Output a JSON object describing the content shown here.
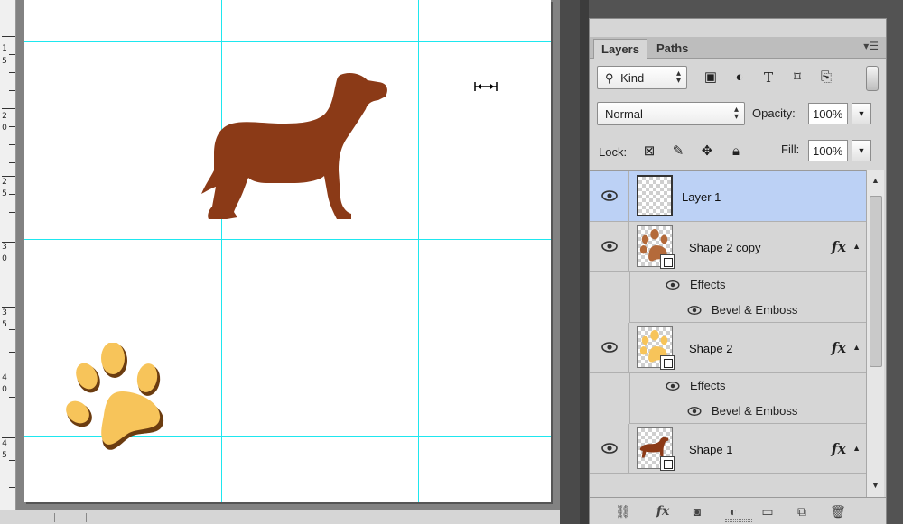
{
  "panel": {
    "collapse_icon": "double-chevron-left-icon",
    "close_icon": "close-icon",
    "tabs": [
      {
        "label": "Layers",
        "active": true
      },
      {
        "label": "Paths",
        "active": false
      }
    ],
    "menu_icon": "panel-menu-icon"
  },
  "filter": {
    "kind_label": "Kind",
    "icons": [
      "image-filter-icon",
      "adjustment-filter-icon",
      "type-filter-icon",
      "shape-filter-icon",
      "smart-object-filter-icon"
    ]
  },
  "blend": {
    "mode": "Normal",
    "opacity_label": "Opacity:",
    "opacity_value": "100%"
  },
  "lock": {
    "label": "Lock:",
    "icons": [
      "lock-transparent-icon",
      "lock-image-icon",
      "lock-position-icon",
      "lock-all-icon"
    ],
    "fill_label": "Fill:",
    "fill_value": "100%"
  },
  "layers": [
    {
      "name": "Layer 1",
      "selected": true,
      "visible": true,
      "thumb": "empty"
    },
    {
      "name": "Shape 2 copy",
      "selected": false,
      "visible": true,
      "thumb": "brown-paw",
      "fx": "fx",
      "effects_label": "Effects",
      "effect": "Bevel & Emboss"
    },
    {
      "name": "Shape 2",
      "selected": false,
      "visible": true,
      "thumb": "yellow-paw",
      "fx": "fx",
      "effects_label": "Effects",
      "effect": "Bevel & Emboss"
    },
    {
      "name": "Shape 1",
      "selected": false,
      "visible": true,
      "thumb": "dog",
      "fx": "fx"
    }
  ],
  "footer_icons": [
    "link-layers-icon",
    "fx-icon",
    "add-mask-icon",
    "adjustment-layer-icon",
    "new-group-icon",
    "new-layer-icon",
    "trash-icon"
  ],
  "canvas": {
    "guide_color": "#1ee7ef",
    "dog_color": "#8b3a17",
    "paw_color": "#f7c45a",
    "paw_shadow_color": "#6b3c10"
  },
  "ruler_numbers": [
    "1",
    "5",
    "2",
    "0",
    "2",
    "5",
    "3",
    "0",
    "3",
    "5",
    "4",
    "0",
    "4",
    "5"
  ]
}
